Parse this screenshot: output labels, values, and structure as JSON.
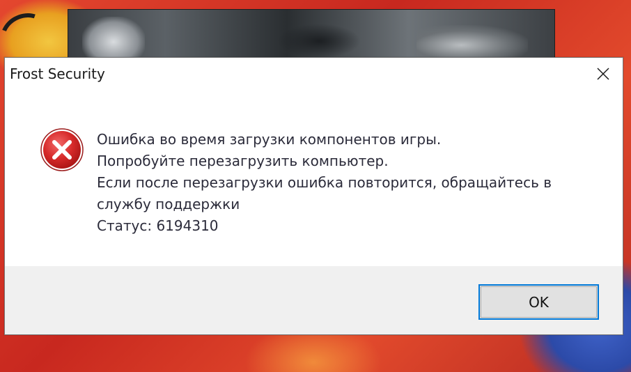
{
  "dialog": {
    "title": "Frost Security",
    "close_icon": "close-icon",
    "error_icon": "error-icon",
    "message_lines": [
      "Ошибка во время загрузки компонентов игры.",
      "Попробуйте перезагрузить компьютер.",
      "Если после перезагрузки ошибка повторится, обращайтесь в",
      "службу поддержки",
      "Статус: 6194310"
    ],
    "ok_label": "OK"
  },
  "colors": {
    "error_red": "#e81123",
    "button_focus_border": "#0078d7",
    "dialog_background": "#f0f0f0",
    "content_background": "#ffffff"
  }
}
